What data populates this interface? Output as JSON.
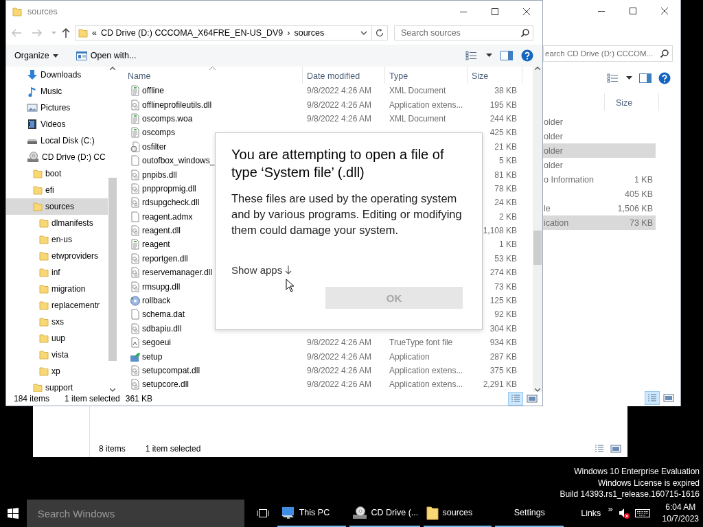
{
  "back_window_right": {
    "search": {
      "placeholder": "earch CD Drive (D:) CCCOM..."
    },
    "size_header": "Size",
    "rows": [
      {
        "type": "older",
        "selected": false
      },
      {
        "type": "older",
        "selected": false
      },
      {
        "type": "older",
        "selected": true
      },
      {
        "type": "older",
        "selected": false
      },
      {
        "type": "o Information",
        "size": "1 KB",
        "selected": false
      },
      {
        "size": "405 KB",
        "selected": false
      },
      {
        "type": "le",
        "size": "1,506 KB",
        "selected": false
      },
      {
        "type": "ication",
        "size": "73 KB",
        "selected": true
      }
    ],
    "views": [
      {
        "kind": "details",
        "selected": true
      },
      {
        "kind": "tiles",
        "selected": false
      }
    ]
  },
  "back_window_lower": {
    "item_count": "8 items",
    "selection": "1 item selected",
    "views": [
      {
        "kind": "details",
        "selected": false
      },
      {
        "kind": "tiles",
        "selected": false
      }
    ]
  },
  "main_window": {
    "title": "sources",
    "address": {
      "overflow": "«",
      "segments": [
        "CD Drive (D:) CCCOMA_X64FRE_EN-US_DV9",
        "sources"
      ],
      "separator": "›"
    },
    "search": {
      "placeholder": "Search sources"
    },
    "toolbar": {
      "organize": "Organize",
      "open_with": "Open with..."
    },
    "nav": [
      {
        "label": "Downloads",
        "kind": "downloads",
        "selected": false
      },
      {
        "label": "Music",
        "kind": "music",
        "selected": false
      },
      {
        "label": "Pictures",
        "kind": "pictures",
        "selected": false
      },
      {
        "label": "Videos",
        "kind": "videos",
        "selected": false
      },
      {
        "label": "Local Disk (C:)",
        "kind": "disk",
        "selected": false
      },
      {
        "label": "CD Drive (D:) CC",
        "kind": "cd",
        "selected": false,
        "children": [
          {
            "label": "boot",
            "kind": "folder",
            "selected": false
          },
          {
            "label": "efi",
            "kind": "folder",
            "selected": false
          },
          {
            "label": "sources",
            "kind": "folder",
            "selected": true,
            "children": [
              {
                "label": "dlmanifests",
                "kind": "folder",
                "selected": false
              },
              {
                "label": "en-us",
                "kind": "folder",
                "selected": false
              },
              {
                "label": "etwproviders",
                "kind": "folder",
                "selected": false
              },
              {
                "label": "inf",
                "kind": "folder",
                "selected": false
              },
              {
                "label": "migration",
                "kind": "folder",
                "selected": false
              },
              {
                "label": "replacementr",
                "kind": "folder",
                "selected": false
              },
              {
                "label": "sxs",
                "kind": "folder",
                "selected": false
              },
              {
                "label": "uup",
                "kind": "folder",
                "selected": false
              },
              {
                "label": "vista",
                "kind": "folder",
                "selected": false
              },
              {
                "label": "xp",
                "kind": "folder",
                "selected": false
              }
            ]
          },
          {
            "label": "support",
            "kind": "folder",
            "selected": false
          }
        ]
      }
    ],
    "columns": [
      "Name",
      "Date modified",
      "Type",
      "Size"
    ],
    "files": [
      {
        "name": "offline",
        "kind": "xml",
        "date": "9/8/2022 4:26 AM",
        "type": "XML Document",
        "size": "38 KB"
      },
      {
        "name": "offlineprofileutils.dll",
        "kind": "dll",
        "date": "9/8/2022 4:26 AM",
        "type": "Application extens...",
        "size": "195 KB"
      },
      {
        "name": "oscomps.woa",
        "kind": "xml",
        "date": "9/8/2022 4:26 AM",
        "type": "XML Document",
        "size": "244 KB"
      },
      {
        "name": "oscomps",
        "kind": "xml",
        "size": "425 KB"
      },
      {
        "name": "osfilter",
        "kind": "sys",
        "size": "21 KB"
      },
      {
        "name": "outofbox_windows_",
        "kind": "blank",
        "size": "5 KB"
      },
      {
        "name": "pnpibs.dll",
        "kind": "dll",
        "size": "81 KB"
      },
      {
        "name": "pnppropmig.dll",
        "kind": "dll",
        "size": "78 KB"
      },
      {
        "name": "rdsupgcheck.dll",
        "kind": "dll",
        "size": "24 KB"
      },
      {
        "name": "reagent.admx",
        "kind": "blank",
        "size": "2 KB"
      },
      {
        "name": "reagent.dll",
        "kind": "dll",
        "size": "1,108 KB"
      },
      {
        "name": "reagent",
        "kind": "xml",
        "size": "1 KB"
      },
      {
        "name": "reportgen.dll",
        "kind": "dll",
        "size": "53 KB"
      },
      {
        "name": "reservemanager.dll",
        "kind": "dll",
        "size": "274 KB"
      },
      {
        "name": "rmsupg.dll",
        "kind": "dll",
        "size": "73 KB"
      },
      {
        "name": "rollback",
        "kind": "app",
        "size": "125 KB"
      },
      {
        "name": "schema.dat",
        "kind": "blank",
        "size": "92 KB"
      },
      {
        "name": "sdbapiu.dll",
        "kind": "dll",
        "size": "304 KB"
      },
      {
        "name": "segoeui",
        "kind": "font",
        "date": "9/8/2022 4:26 AM",
        "type": "TrueType font file",
        "size": "934 KB"
      },
      {
        "name": "setup",
        "kind": "setup",
        "date": "9/8/2022 4:26 AM",
        "type": "Application",
        "size": "287 KB"
      },
      {
        "name": "setupcompat.dll",
        "kind": "dll",
        "date": "9/8/2022 4:26 AM",
        "type": "Application extens...",
        "size": "375 KB"
      },
      {
        "name": "setupcore.dll",
        "kind": "dll",
        "date": "9/8/2022 4:26 AM",
        "type": "Application extens...",
        "size": "2,291 KB"
      }
    ],
    "status_bar": {
      "item_count": "184 items",
      "selection": "1 item selected",
      "selection_size": "361 KB",
      "views": [
        {
          "kind": "details",
          "selected": true
        },
        {
          "kind": "tiles",
          "selected": false
        }
      ]
    }
  },
  "dialog": {
    "title": "You are attempting to open a file of type ‘System file’ (.dll)",
    "message": "These files are used by the operating system and by various programs. Editing or modifying them could damage your system.",
    "show_apps": "Show apps",
    "ok": {
      "label": "OK",
      "disabled": true
    }
  },
  "desktop_notice": [
    "Windows 10 Enterprise Evaluation",
    "Windows License is expired",
    "Build 14393.rs1_release.160715-1616"
  ],
  "taskbar": {
    "search": {
      "placeholder": "Search Windows"
    },
    "apps": [
      {
        "label": "This PC",
        "kind": "monitor",
        "running": true
      },
      {
        "label": "CD Drive (...",
        "kind": "cd",
        "running": true
      },
      {
        "label": "sources",
        "kind": "folder",
        "running": true
      },
      {
        "label": "Settings",
        "kind": "none",
        "running": true
      }
    ],
    "links": "Links",
    "overflow": "»",
    "volume": {
      "muted": true
    },
    "clock": {
      "time": "6:04 AM",
      "date": "10/7/2023"
    }
  }
}
